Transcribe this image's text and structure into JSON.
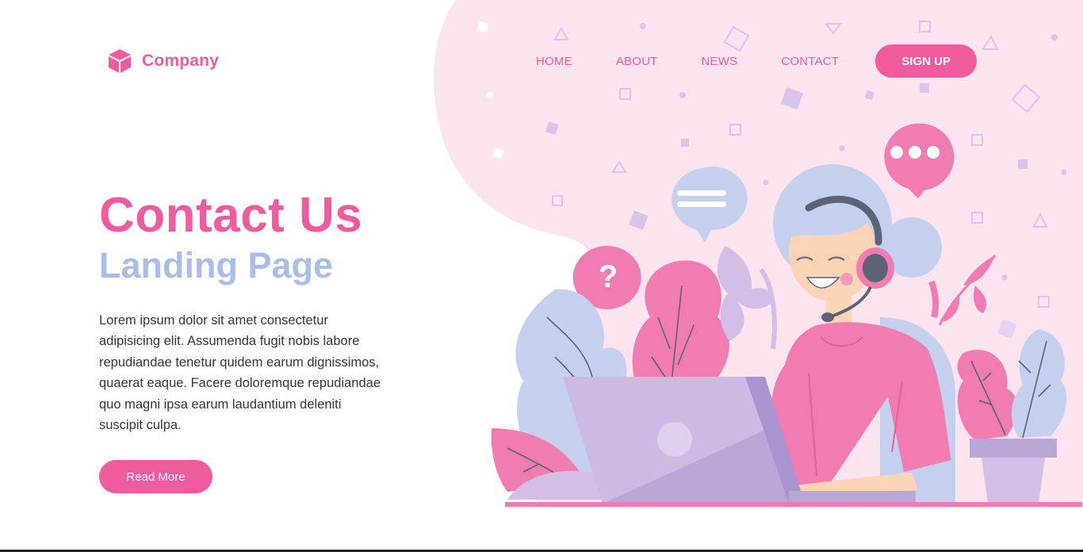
{
  "brand": {
    "name": "Company",
    "icon": "cube-icon",
    "color": "#ef5b9c"
  },
  "nav": {
    "items": [
      {
        "label": "HOME"
      },
      {
        "label": "ABOUT"
      },
      {
        "label": "NEWS"
      },
      {
        "label": "CONTACT"
      }
    ],
    "signup_label": "SIGN UP"
  },
  "hero": {
    "title": "Contact Us",
    "subtitle": "Landing Page",
    "body": "Lorem ipsum dolor sit amet consectetur adipisicing elit. Assumenda fugit nobis labore repudiandae tenetur quidem earum dignissimos, quaerat eaque. Facere doloremque repudiandae quo magni ipsa earum laudantium deleniti suscipit culpa.",
    "cta_label": "Read More"
  },
  "illustration": {
    "subject": "customer-support-agent-with-headset-and-laptop",
    "icons": [
      "question-bubble-icon",
      "typing-bubble-icon",
      "message-bubble-icon"
    ]
  },
  "colors": {
    "accent": "#ef5b9c",
    "subtitle": "#a9bde8",
    "background_blob": "#fbe4ee",
    "lavender": "#c9b6e3",
    "periwinkle": "#c4d0ee"
  }
}
